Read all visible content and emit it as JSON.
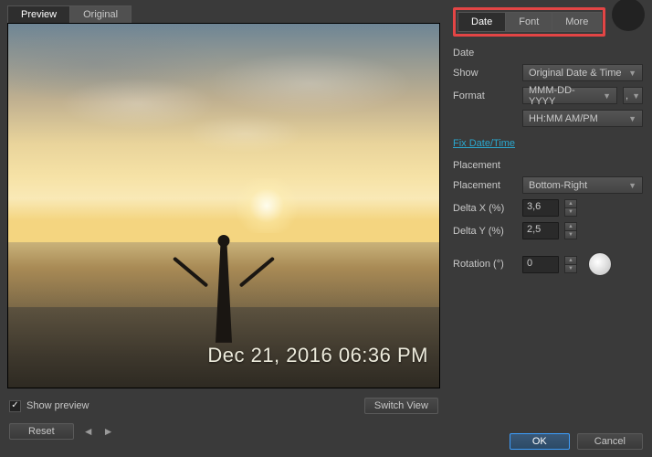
{
  "left": {
    "tabs": {
      "preview": "Preview",
      "original": "Original"
    },
    "stamp_text": "Dec 21, 2016 06:36 PM",
    "show_preview_label": "Show preview",
    "show_preview_checked": true,
    "switch_view_label": "Switch View",
    "reset_label": "Reset"
  },
  "panel": {
    "tabs": {
      "date": "Date",
      "font": "Font",
      "more": "More"
    },
    "date": {
      "title": "Date",
      "show_label": "Show",
      "show_value": "Original Date & Time",
      "format_label": "Format",
      "date_format_value": "MMM-DD-YYYY",
      "separator_value": ",",
      "time_format_value": "HH:MM AM/PM",
      "fix_link": "Fix Date/Time"
    },
    "placement": {
      "title": "Placement",
      "placement_label": "Placement",
      "placement_value": "Bottom-Right",
      "dx_label": "Delta X (%)",
      "dx_value": "3,6",
      "dy_label": "Delta Y (%)",
      "dy_value": "2,5",
      "rotation_label": "Rotation (°)",
      "rotation_value": "0"
    }
  },
  "footer": {
    "ok_label": "OK",
    "cancel_label": "Cancel"
  }
}
